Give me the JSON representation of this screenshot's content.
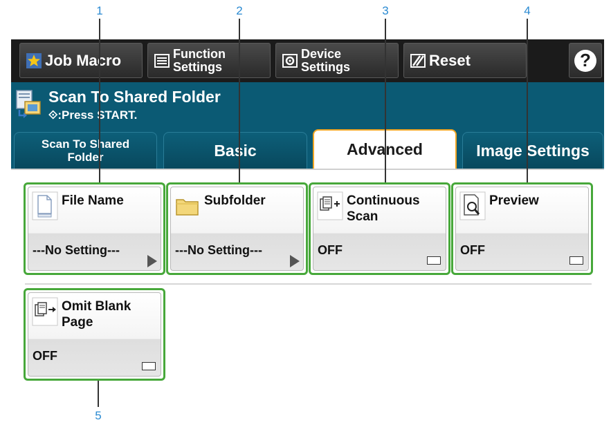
{
  "toolbar": {
    "job_macro": "Job Macro",
    "function_settings_1": "Function",
    "function_settings_2": "Settings",
    "device_settings_1": "Device",
    "device_settings_2": "Settings",
    "reset": "Reset",
    "help": "?"
  },
  "header": {
    "title": "Scan To Shared Folder",
    "subtitle": "⟐:Press START."
  },
  "tabs": [
    {
      "label_1": "Scan To Shared",
      "label_2": "Folder"
    },
    {
      "label": "Basic"
    },
    {
      "label": "Advanced"
    },
    {
      "label": "Image Settings"
    }
  ],
  "functions": [
    {
      "name": "File Name",
      "value": "---No Setting---",
      "icon": "file-icon"
    },
    {
      "name": "Subfolder",
      "value": "---No Setting---",
      "icon": "folder-icon"
    },
    {
      "name_1": "Continuous",
      "name_2": "Scan",
      "value": "OFF",
      "icon": "continuous-scan-icon"
    },
    {
      "name": "Preview",
      "value": "OFF",
      "icon": "preview-icon"
    },
    {
      "name_1": "Omit Blank",
      "name_2": "Page",
      "value": "OFF",
      "icon": "omit-blank-page-icon"
    }
  ],
  "callouts": [
    "1",
    "2",
    "3",
    "4",
    "5"
  ],
  "colors": {
    "toolbar_bg": "#1b1b1b",
    "header_bg": "#0b5a74",
    "active_tab_border": "#f2a623",
    "highlight_frame": "#47a83a",
    "callout_text": "#2a8ad2"
  }
}
